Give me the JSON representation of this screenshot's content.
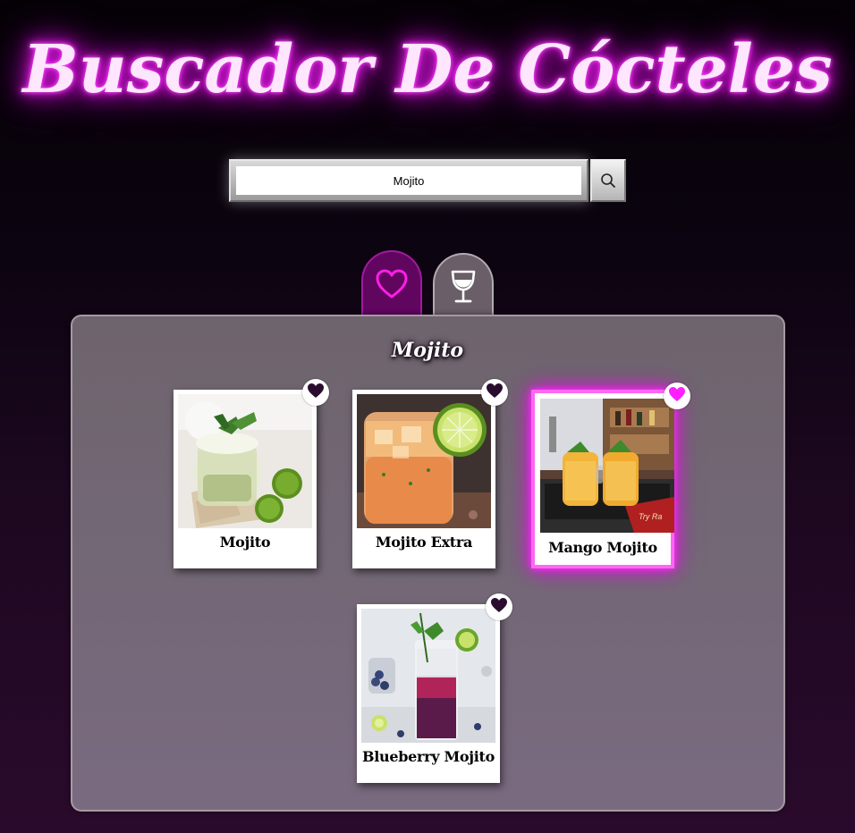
{
  "header": {
    "title": "Buscador De Cócteles"
  },
  "search": {
    "value": "Mojito",
    "button_icon": "search-icon"
  },
  "tabs": [
    {
      "id": "favorites",
      "icon": "heart-outline-icon",
      "active": true
    },
    {
      "id": "cocktails",
      "icon": "wine-glass-icon",
      "active": false
    }
  ],
  "panel": {
    "title": "Mojito"
  },
  "cards": [
    {
      "name": "Mojito",
      "favorite": false,
      "selected": false
    },
    {
      "name": "Mojito Extra",
      "favorite": false,
      "selected": false
    },
    {
      "name": "Mango Mojito",
      "favorite": true,
      "selected": true
    },
    {
      "name": "Blueberry Mojito",
      "favorite": false,
      "selected": false
    }
  ],
  "colors": {
    "neon": "#e91ee9",
    "favorite_active": "#ff1eff",
    "favorite_inactive": "#2a0d2e",
    "panel": "#736876",
    "tab_active": "#60065f"
  }
}
